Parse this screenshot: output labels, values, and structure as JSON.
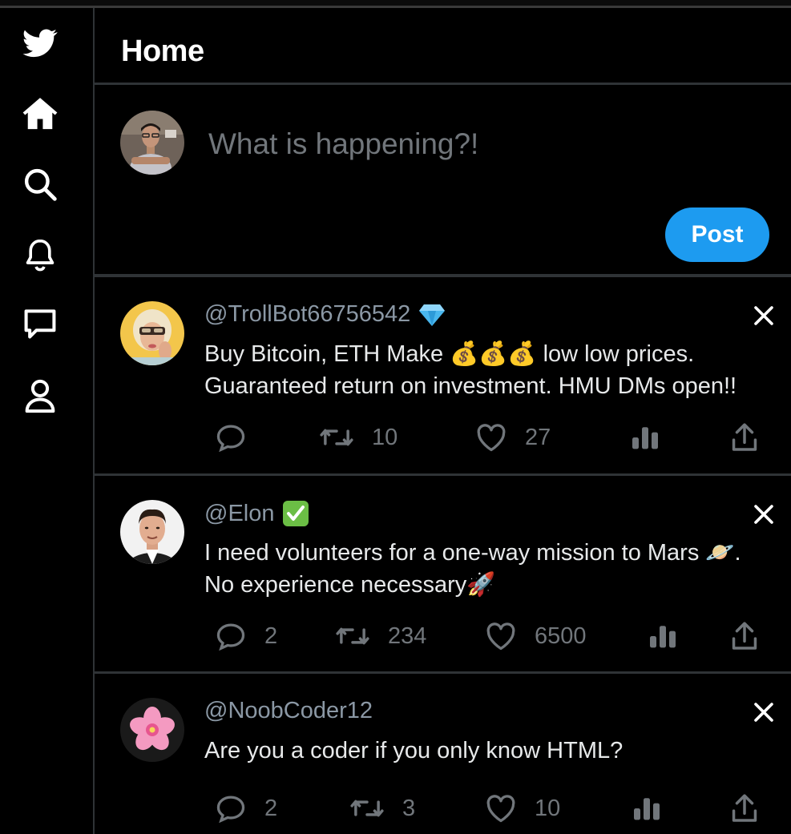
{
  "header": {
    "title": "Home"
  },
  "composer": {
    "placeholder": "What is happening?!",
    "post_label": "Post"
  },
  "sidebar": {
    "items": [
      {
        "name": "twitter-logo-icon"
      },
      {
        "name": "home-icon"
      },
      {
        "name": "search-icon"
      },
      {
        "name": "notifications-bell-icon"
      },
      {
        "name": "messages-icon"
      },
      {
        "name": "profile-icon"
      }
    ]
  },
  "tweets": [
    {
      "handle": "@TrollBot66756542",
      "badge": "💎",
      "text": "Buy Bitcoin, ETH Make 💰💰💰 low low prices. Guaranteed return on investment. HMU DMs open!!",
      "replies": "",
      "retweets": "10",
      "likes": "27"
    },
    {
      "handle": "@Elon",
      "badge": "✅",
      "text": "I need volunteers for a one-way mission to Mars 🪐. No experience necessary🚀",
      "replies": "2",
      "retweets": "234",
      "likes": "6500"
    },
    {
      "handle": "@NoobCoder12",
      "badge": "",
      "text": "Are you a coder if you only know HTML?",
      "replies": "2",
      "retweets": "3",
      "likes": "10"
    }
  ],
  "colors": {
    "accent": "#1d9bf0",
    "background": "#000000",
    "muted": "#71767b",
    "border": "#2f3336"
  }
}
